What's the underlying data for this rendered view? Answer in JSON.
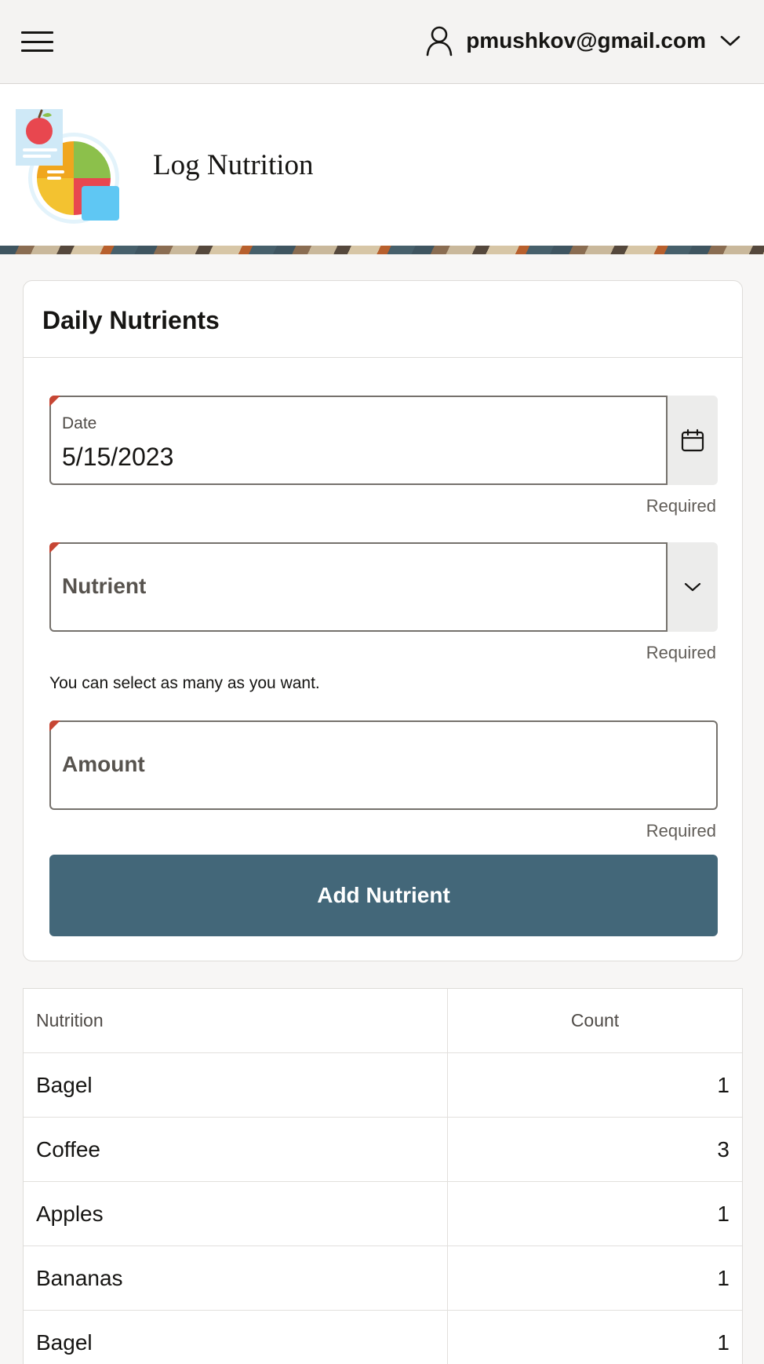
{
  "header": {
    "user_email": "pmushkov@gmail.com"
  },
  "banner": {
    "title": "Log Nutrition"
  },
  "form": {
    "card_title": "Daily Nutrients",
    "date": {
      "label": "Date",
      "value": "5/15/2023",
      "required_text": "Required"
    },
    "nutrient": {
      "placeholder": "Nutrient",
      "required_text": "Required",
      "help_text": "You can select as many as you want."
    },
    "amount": {
      "placeholder": "Amount",
      "required_text": "Required"
    },
    "submit_label": "Add Nutrient"
  },
  "table": {
    "headers": {
      "name": "Nutrition",
      "count": "Count"
    },
    "rows": [
      {
        "name": "Bagel",
        "count": "1"
      },
      {
        "name": "Coffee",
        "count": "3"
      },
      {
        "name": "Apples",
        "count": "1"
      },
      {
        "name": "Bananas",
        "count": "1"
      },
      {
        "name": "Bagel",
        "count": "1"
      }
    ]
  },
  "colors": {
    "primary_button": "#436779",
    "required_flag": "#c74634"
  },
  "icons": [
    "hamburger-menu-icon",
    "user-icon",
    "chevron-down-icon",
    "calendar-icon",
    "nutrition-logo"
  ]
}
